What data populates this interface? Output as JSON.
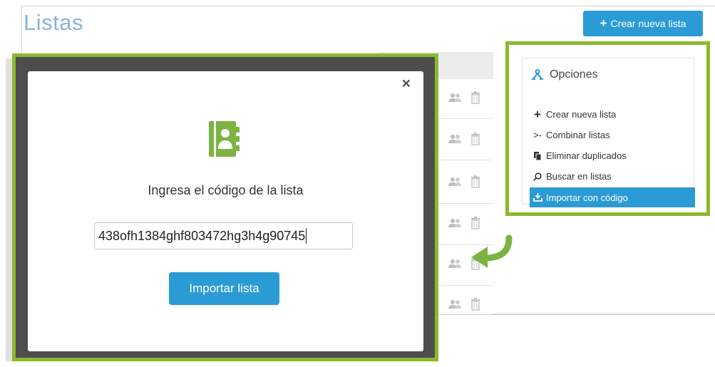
{
  "page": {
    "title": "Listas",
    "create_button_label": "Crear nueva lista"
  },
  "options_panel": {
    "title": "Opciones",
    "items": [
      {
        "icon": "plus-icon",
        "label": "Crear nueva lista"
      },
      {
        "icon": "merge-icon",
        "label": "Combinar listas"
      },
      {
        "icon": "copy-icon",
        "label": "Eliminar duplicados"
      },
      {
        "icon": "search-icon",
        "label": "Buscar en listas"
      },
      {
        "icon": "import-icon",
        "label": "Importar con código",
        "active": true
      }
    ]
  },
  "modal": {
    "close_label": "×",
    "prompt": "Ingresa el código de la lista",
    "code_value": "438ofh1384ghf803472hg3h4g90745",
    "import_button_label": "Importar lista"
  },
  "colors": {
    "accent_blue": "#2b9bd6",
    "highlight_green": "#8ab92d",
    "icon_green": "#7cb342"
  }
}
